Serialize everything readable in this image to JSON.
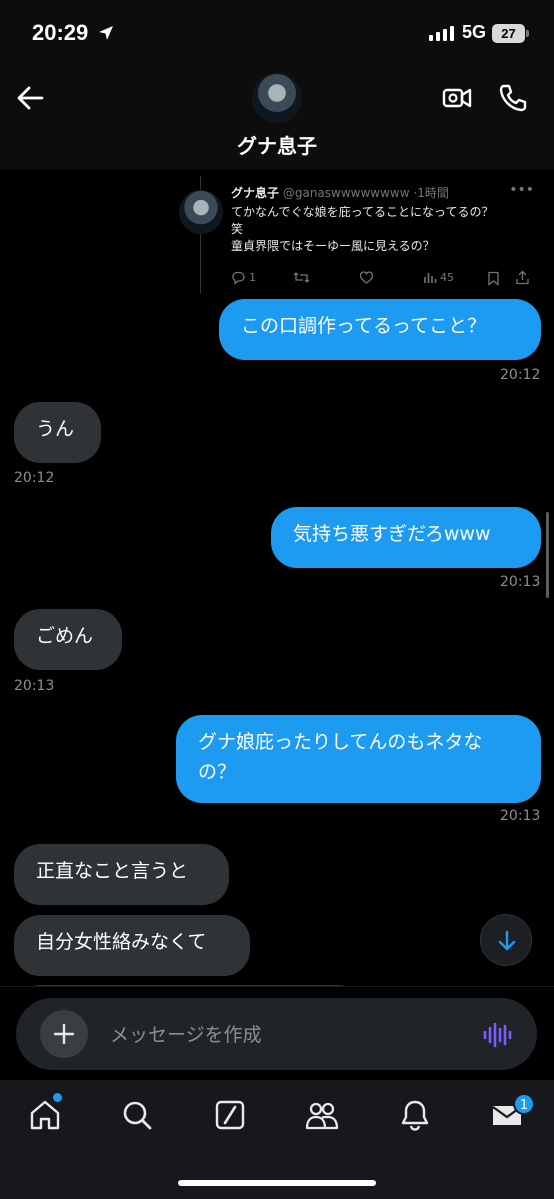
{
  "status_bar": {
    "time": "20:29",
    "network": "5G",
    "battery": "27"
  },
  "header": {
    "name": "グナ息子"
  },
  "quoted_tweet": {
    "author": "グナ息子",
    "handle": "@ganaswwwwwwww",
    "age": "1時間",
    "lines": [
      "てかなんでぐな娘を庇ってることになってるの？",
      "笑",
      "童貞界隈ではそーゆー風に見えるの？"
    ],
    "replies": "1",
    "views": "45"
  },
  "messages": [
    {
      "dir": "out",
      "text": "この口調作ってるってこと？",
      "time": "20:12"
    },
    {
      "dir": "in",
      "text": "うん",
      "time": "20:12"
    },
    {
      "dir": "out",
      "text": "気持ち悪すぎだろwww",
      "time": "20:13"
    },
    {
      "dir": "in",
      "text": "ごめん",
      "time": "20:13"
    },
    {
      "dir": "out",
      "text_line1": "グナ娘庇ったりしてんのもネタな",
      "text_line2": "の？",
      "time": "20:13"
    },
    {
      "dir": "in",
      "text": "正直なこと言うと"
    },
    {
      "dir": "in",
      "text": "自分女性絡みなくて"
    }
  ],
  "composer": {
    "placeholder": "メッセージを作成"
  },
  "tabbar": {
    "messages_badge": "1"
  },
  "colors": {
    "accent": "#1d9bf0",
    "incoming_bubble": "#2f3336",
    "background": "#000000",
    "voice_icon": "#7c5cff"
  }
}
